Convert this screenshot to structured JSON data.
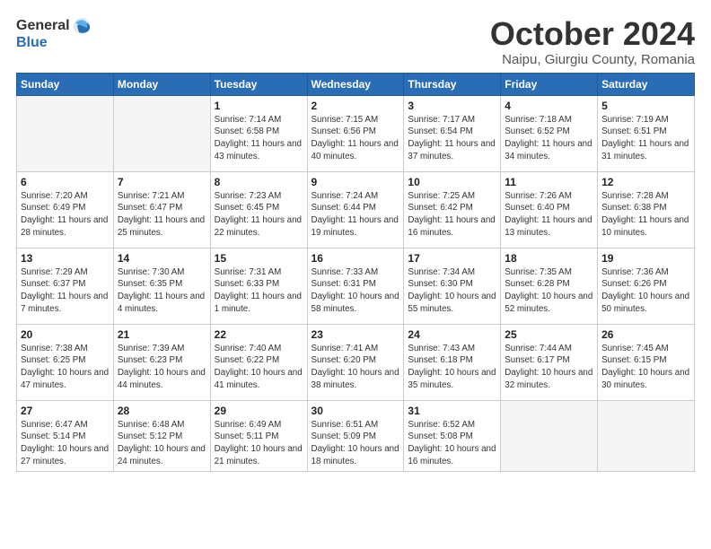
{
  "logo": {
    "general": "General",
    "blue": "Blue"
  },
  "title": "October 2024",
  "subtitle": "Naipu, Giurgiu County, Romania",
  "days_of_week": [
    "Sunday",
    "Monday",
    "Tuesday",
    "Wednesday",
    "Thursday",
    "Friday",
    "Saturday"
  ],
  "weeks": [
    [
      {
        "day": "",
        "info": ""
      },
      {
        "day": "",
        "info": ""
      },
      {
        "day": "1",
        "info": "Sunrise: 7:14 AM\nSunset: 6:58 PM\nDaylight: 11 hours and 43 minutes."
      },
      {
        "day": "2",
        "info": "Sunrise: 7:15 AM\nSunset: 6:56 PM\nDaylight: 11 hours and 40 minutes."
      },
      {
        "day": "3",
        "info": "Sunrise: 7:17 AM\nSunset: 6:54 PM\nDaylight: 11 hours and 37 minutes."
      },
      {
        "day": "4",
        "info": "Sunrise: 7:18 AM\nSunset: 6:52 PM\nDaylight: 11 hours and 34 minutes."
      },
      {
        "day": "5",
        "info": "Sunrise: 7:19 AM\nSunset: 6:51 PM\nDaylight: 11 hours and 31 minutes."
      }
    ],
    [
      {
        "day": "6",
        "info": "Sunrise: 7:20 AM\nSunset: 6:49 PM\nDaylight: 11 hours and 28 minutes."
      },
      {
        "day": "7",
        "info": "Sunrise: 7:21 AM\nSunset: 6:47 PM\nDaylight: 11 hours and 25 minutes."
      },
      {
        "day": "8",
        "info": "Sunrise: 7:23 AM\nSunset: 6:45 PM\nDaylight: 11 hours and 22 minutes."
      },
      {
        "day": "9",
        "info": "Sunrise: 7:24 AM\nSunset: 6:44 PM\nDaylight: 11 hours and 19 minutes."
      },
      {
        "day": "10",
        "info": "Sunrise: 7:25 AM\nSunset: 6:42 PM\nDaylight: 11 hours and 16 minutes."
      },
      {
        "day": "11",
        "info": "Sunrise: 7:26 AM\nSunset: 6:40 PM\nDaylight: 11 hours and 13 minutes."
      },
      {
        "day": "12",
        "info": "Sunrise: 7:28 AM\nSunset: 6:38 PM\nDaylight: 11 hours and 10 minutes."
      }
    ],
    [
      {
        "day": "13",
        "info": "Sunrise: 7:29 AM\nSunset: 6:37 PM\nDaylight: 11 hours and 7 minutes."
      },
      {
        "day": "14",
        "info": "Sunrise: 7:30 AM\nSunset: 6:35 PM\nDaylight: 11 hours and 4 minutes."
      },
      {
        "day": "15",
        "info": "Sunrise: 7:31 AM\nSunset: 6:33 PM\nDaylight: 11 hours and 1 minute."
      },
      {
        "day": "16",
        "info": "Sunrise: 7:33 AM\nSunset: 6:31 PM\nDaylight: 10 hours and 58 minutes."
      },
      {
        "day": "17",
        "info": "Sunrise: 7:34 AM\nSunset: 6:30 PM\nDaylight: 10 hours and 55 minutes."
      },
      {
        "day": "18",
        "info": "Sunrise: 7:35 AM\nSunset: 6:28 PM\nDaylight: 10 hours and 52 minutes."
      },
      {
        "day": "19",
        "info": "Sunrise: 7:36 AM\nSunset: 6:26 PM\nDaylight: 10 hours and 50 minutes."
      }
    ],
    [
      {
        "day": "20",
        "info": "Sunrise: 7:38 AM\nSunset: 6:25 PM\nDaylight: 10 hours and 47 minutes."
      },
      {
        "day": "21",
        "info": "Sunrise: 7:39 AM\nSunset: 6:23 PM\nDaylight: 10 hours and 44 minutes."
      },
      {
        "day": "22",
        "info": "Sunrise: 7:40 AM\nSunset: 6:22 PM\nDaylight: 10 hours and 41 minutes."
      },
      {
        "day": "23",
        "info": "Sunrise: 7:41 AM\nSunset: 6:20 PM\nDaylight: 10 hours and 38 minutes."
      },
      {
        "day": "24",
        "info": "Sunrise: 7:43 AM\nSunset: 6:18 PM\nDaylight: 10 hours and 35 minutes."
      },
      {
        "day": "25",
        "info": "Sunrise: 7:44 AM\nSunset: 6:17 PM\nDaylight: 10 hours and 32 minutes."
      },
      {
        "day": "26",
        "info": "Sunrise: 7:45 AM\nSunset: 6:15 PM\nDaylight: 10 hours and 30 minutes."
      }
    ],
    [
      {
        "day": "27",
        "info": "Sunrise: 6:47 AM\nSunset: 5:14 PM\nDaylight: 10 hours and 27 minutes."
      },
      {
        "day": "28",
        "info": "Sunrise: 6:48 AM\nSunset: 5:12 PM\nDaylight: 10 hours and 24 minutes."
      },
      {
        "day": "29",
        "info": "Sunrise: 6:49 AM\nSunset: 5:11 PM\nDaylight: 10 hours and 21 minutes."
      },
      {
        "day": "30",
        "info": "Sunrise: 6:51 AM\nSunset: 5:09 PM\nDaylight: 10 hours and 18 minutes."
      },
      {
        "day": "31",
        "info": "Sunrise: 6:52 AM\nSunset: 5:08 PM\nDaylight: 10 hours and 16 minutes."
      },
      {
        "day": "",
        "info": ""
      },
      {
        "day": "",
        "info": ""
      }
    ]
  ]
}
